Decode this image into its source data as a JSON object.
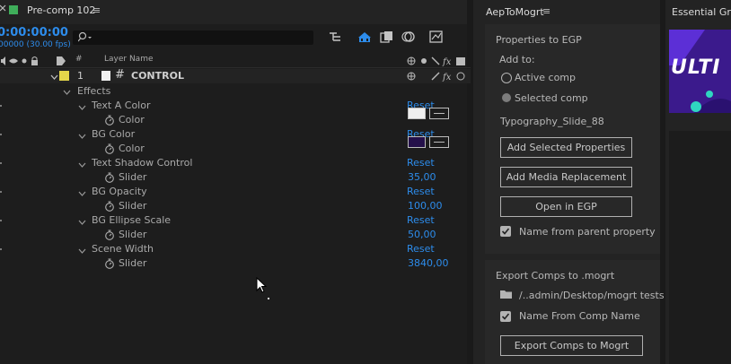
{
  "timeline": {
    "comp_name": "Pre-comp 102",
    "timecode": "0:00:00:00",
    "frames_fps": "00000 (30.00 fps)",
    "col_hash": "#",
    "col_layer_name": "Layer Name",
    "layer_number": "1",
    "layer_hash": "#",
    "layer_name": "CONTROL",
    "effects_label": "Effects",
    "effects": [
      {
        "name": "Text A Color",
        "reset": "Reset",
        "prop": "Color",
        "type": "color",
        "color": "#eeeeee"
      },
      {
        "name": "BG Color",
        "reset": "Reset",
        "prop": "Color",
        "type": "color",
        "color": "#24104a"
      },
      {
        "name": "Text Shadow Control",
        "reset": "Reset",
        "prop": "Slider",
        "type": "value",
        "value": "35,00"
      },
      {
        "name": "BG Opacity",
        "reset": "Reset",
        "prop": "Slider",
        "type": "value",
        "value": "100,00"
      },
      {
        "name": "BG Ellipse Scale",
        "reset": "Reset",
        "prop": "Slider",
        "type": "value",
        "value": "50,00"
      },
      {
        "name": "Scene Width",
        "reset": "Reset",
        "prop": "Slider",
        "type": "value",
        "value": "3840,00"
      }
    ]
  },
  "aep": {
    "title": "AepToMogrt",
    "section1": "Properties to EGP",
    "add_to": "Add to:",
    "radio_active": "Active comp",
    "radio_selected": "Selected comp",
    "comp_name": "Typography_Slide_88",
    "btn_add_selected": "Add Selected Properties",
    "btn_add_media": "Add Media Replacement",
    "btn_open_egp": "Open in EGP",
    "chk_parent": "Name from parent property",
    "section2": "Export Comps to .mogrt",
    "folder_path": "/..admin/Desktop/mogrt tests",
    "chk_comp_name": "Name From Comp Name",
    "btn_export": "Export Comps to Mogrt"
  },
  "egp": {
    "title": "Essential Graph",
    "thumb_text": "ULTI"
  },
  "colors": {
    "accent": "#2d8ceb",
    "label_yellow": "#e5d64a",
    "thumb_bg": "#3b1a8c",
    "thumb_teal": "#2fd6c0"
  }
}
